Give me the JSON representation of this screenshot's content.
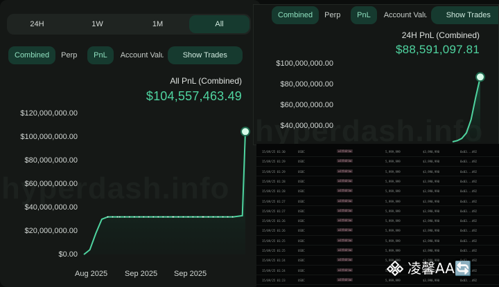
{
  "left": {
    "range_tabs": [
      "24H",
      "1W",
      "1M",
      "All"
    ],
    "active_range": "All",
    "mode_tabs": [
      "Combined",
      "Perp",
      "PnL",
      "Account Value"
    ],
    "show_trades_label": "Show Trades",
    "pnl_label": "All PnL (Combined)",
    "pnl_value": "$104,557,463.49",
    "watermark": "hyperdash.info",
    "y_ticks": [
      "$120,000,000.00",
      "$100,000,000.00",
      "$80,000,000.00",
      "$60,000,000.00",
      "$40,000,000.00",
      "$20,000,000.00",
      "$0.00"
    ],
    "x_ticks": [
      "Aug 2025",
      "Sep 2025",
      "Sep 2025"
    ]
  },
  "right_top": {
    "mode_tabs": [
      "Combined",
      "Perp",
      "PnL",
      "Account Value"
    ],
    "show_trades_label": "Show Trades",
    "pnl_label": "24H PnL (Combined)",
    "pnl_value": "$88,591,097.81",
    "watermark": "hyperdash.info",
    "y_ticks": [
      "$100,000,000.00",
      "$80,000,000.00",
      "$60,000,000.00",
      "$40,000,000.00"
    ]
  },
  "table": {
    "rows": [
      [
        "15/09/25 01:30",
        "USDC",
        "withdraw",
        "5,999,999",
        "$3,990,990",
        "0x03...d92"
      ],
      [
        "15/09/25 01:29",
        "USDC",
        "withdraw",
        "5,999,999",
        "$3,990,990",
        "0x03...d92"
      ],
      [
        "15/09/25 01:29",
        "USDC",
        "withdraw",
        "5,999,999",
        "$3,990,990",
        "0x03...d92"
      ],
      [
        "15/09/25 01:28",
        "USDC",
        "withdraw",
        "5,999,999",
        "$3,990,990",
        "0x03...d92"
      ],
      [
        "15/09/25 01:28",
        "USDC",
        "withdraw",
        "5,999,999",
        "$3,990,990",
        "0x03...d92"
      ],
      [
        "15/09/25 01:27",
        "USDC",
        "withdraw",
        "5,999,999",
        "$3,990,990",
        "0x03...d92"
      ],
      [
        "15/09/25 01:27",
        "USDC",
        "withdraw",
        "5,999,999",
        "$3,990,990",
        "0x03...d92"
      ],
      [
        "15/09/25 01:26",
        "USDC",
        "withdraw",
        "5,999,999",
        "$3,990,990",
        "0x03...d92"
      ],
      [
        "15/09/25 01:26",
        "USDC",
        "withdraw",
        "5,999,999",
        "$3,990,990",
        "0x03...d92"
      ],
      [
        "15/09/25 01:25",
        "USDC",
        "withdraw",
        "5,999,999",
        "$3,990,990",
        "0x03...d92"
      ],
      [
        "15/09/25 01:25",
        "USDC",
        "withdraw",
        "5,999,999",
        "$3,990,990",
        "0x03...d92"
      ],
      [
        "15/09/25 01:24",
        "USDC",
        "withdraw",
        "5,999,999",
        "$3,990,990",
        "0x03...d92"
      ],
      [
        "15/09/25 01:24",
        "USDC",
        "withdraw",
        "5,999,999",
        "$3,990,990",
        "0x03...d92"
      ],
      [
        "15/09/25 01:23",
        "USDC",
        "withdraw",
        "5,999,999",
        "$3,990,990",
        "0x03...d92"
      ]
    ]
  },
  "brand_text": "凌馨AA🔄",
  "colors": {
    "accent": "#4fd4a0",
    "panel": "#151816",
    "tab_active": "#163a2f"
  },
  "chart_data": [
    {
      "type": "area",
      "series": [
        {
          "values": [
            0,
            4000000,
            18000000,
            30000000,
            32000000,
            32000000,
            32000000,
            32000000,
            32000000,
            32000000,
            33000000,
            104557463
          ]
        }
      ],
      "x": [
        0,
        4,
        8,
        12,
        16,
        24,
        40,
        60,
        80,
        100,
        106,
        108
      ],
      "ylim": [
        0,
        120000000
      ]
    },
    {
      "type": "area",
      "series": [
        {
          "values": [
            30000000,
            31000000,
            33000000,
            38000000,
            50000000,
            70000000,
            88591097
          ]
        }
      ],
      "x": [
        0,
        1,
        2,
        3,
        4,
        5,
        6
      ],
      "ylim": [
        30000000,
        100000000
      ]
    }
  ]
}
